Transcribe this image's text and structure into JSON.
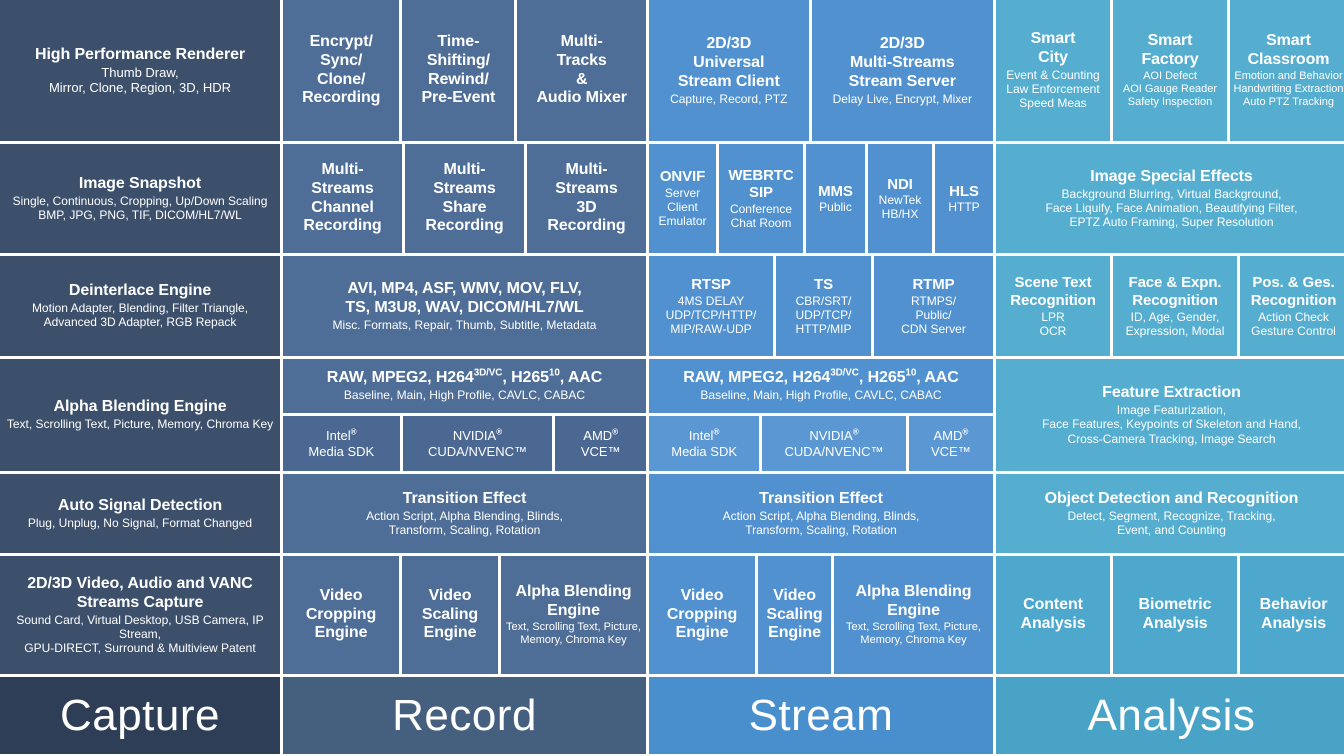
{
  "title": "Capture / Record / Stream / Analysis Feature Matrix",
  "colors": {
    "capture": "#3c4f6b",
    "record": "#4e6d97",
    "stream": "#5191cf",
    "analysis": "#55aed0",
    "footer_capture": "#2e3e56",
    "footer_record": "#45607f",
    "footer_stream": "#4a8fcd",
    "footer_analysis": "#48a3c6",
    "gap": "#ffffff"
  },
  "footer": {
    "capture": "Capture",
    "record": "Record",
    "stream": "Stream",
    "analysis": "Analysis"
  },
  "rows": [
    {
      "id": "row-1",
      "capture": {
        "title": "High Performance Renderer",
        "sub": [
          "Thumb Draw,",
          "Mirror, Clone, Region, 3D, HDR"
        ]
      },
      "record": [
        {
          "title": [
            "Encrypt/",
            "Sync/",
            "Clone/",
            "Recording"
          ]
        },
        {
          "title": [
            "Time-",
            "Shifting/",
            "Rewind/",
            "Pre-Event"
          ]
        },
        {
          "title": [
            "Multi-",
            "Tracks",
            "&",
            "Audio Mixer"
          ]
        }
      ],
      "stream": [
        {
          "title": [
            "2D/3D",
            "Universal",
            "Stream Client"
          ],
          "sub": [
            "Capture, Record, PTZ"
          ]
        },
        {
          "title": [
            "2D/3D",
            "Multi-Streams",
            "Stream Server"
          ],
          "sub": [
            "Delay Live, Encrypt, Mixer"
          ]
        }
      ],
      "analysis": [
        {
          "title": [
            "Smart",
            "City"
          ],
          "sub": [
            "Event & Counting",
            "Law Enforcement",
            "Speed Meas"
          ]
        },
        {
          "title": [
            "Smart",
            "Factory"
          ],
          "sub": [
            "AOI Defect",
            "AOI Gauge Reader",
            "Safety Inspection"
          ]
        },
        {
          "title": [
            "Smart",
            "Classroom"
          ],
          "sub": [
            "Emotion and Behavior",
            "Handwriting Extraction",
            "Auto PTZ Tracking"
          ]
        }
      ]
    },
    {
      "id": "row-2",
      "capture": {
        "title": "Image Snapshot",
        "sub": [
          "Single, Continuous, Cropping, Up/Down Scaling",
          "BMP, JPG, PNG, TIF, DICOM/HL7/WL"
        ]
      },
      "record": [
        {
          "title": [
            "Multi-",
            "Streams",
            "Channel",
            "Recording"
          ]
        },
        {
          "title": [
            "Multi-",
            "Streams",
            "Share",
            "Recording"
          ]
        },
        {
          "title": [
            "Multi-",
            "Streams",
            "3D",
            "Recording"
          ]
        }
      ],
      "stream": [
        {
          "title": [
            "ONVIF"
          ],
          "sub": [
            "Server",
            "Client",
            "Emulator"
          ]
        },
        {
          "title": [
            "WEBRTC",
            "SIP"
          ],
          "sub": [
            "Conference",
            "Chat Room"
          ]
        },
        {
          "title": [
            "MMS"
          ],
          "sub": [
            "Public"
          ]
        },
        {
          "title": [
            "NDI"
          ],
          "sub": [
            "NewTek",
            "HB/HX"
          ]
        },
        {
          "title": [
            "HLS"
          ],
          "sub": [
            "HTTP"
          ]
        }
      ],
      "analysis": [
        {
          "title": [
            "Image Special Effects"
          ],
          "sub": [
            "Background Blurring, Virtual Background,",
            "Face Liquify, Face Animation, Beautifying Filter,",
            "EPTZ Auto Framing, Super Resolution"
          ]
        }
      ]
    },
    {
      "id": "row-3",
      "capture": {
        "title": "Deinterlace Engine",
        "sub": [
          "Motion Adapter, Blending, Filter Triangle,",
          "Advanced 3D Adapter, RGB Repack"
        ]
      },
      "record": [
        {
          "title": [
            "AVI, MP4, ASF, WMV, MOV, FLV,",
            "TS, M3U8, WAV, DICOM/HL7/WL"
          ],
          "sub": [
            "Misc. Formats, Repair, Thumb, Subtitle, Metadata"
          ]
        }
      ],
      "stream": [
        {
          "title": [
            "RTSP"
          ],
          "sub": [
            "4MS DELAY",
            "UDP/TCP/HTTP/",
            "MIP/RAW-UDP"
          ]
        },
        {
          "title": [
            "TS"
          ],
          "sub": [
            "CBR/SRT/",
            "UDP/TCP/",
            "HTTP/MIP"
          ]
        },
        {
          "title": [
            "RTMP"
          ],
          "sub": [
            "RTMPS/",
            "Public/",
            "CDN Server"
          ]
        }
      ],
      "analysis": [
        {
          "title": [
            "Scene Text",
            "Recognition"
          ],
          "sub": [
            "LPR",
            "OCR"
          ]
        },
        {
          "title": [
            "Face & Expn.",
            "Recognition"
          ],
          "sub": [
            "ID, Age, Gender,",
            "Expression, Modal"
          ]
        },
        {
          "title": [
            "Pos. & Ges.",
            "Recognition"
          ],
          "sub": [
            "Action Check",
            "Gesture Control"
          ]
        }
      ]
    },
    {
      "id": "row-4",
      "capture": {
        "title": "Alpha Blending Engine",
        "sub": [
          "Text, Scrolling Text, Picture, Memory, Chroma Key"
        ]
      },
      "record_top": {
        "title_html": "RAW, MPEG2, H264<sup>3D/VC</sup>, H265<sup>10</sup>, AAC",
        "sub": [
          "Baseline, Main, High Profile, CAVLC, CABAC"
        ]
      },
      "record_bottom": [
        {
          "title_html": "Intel<sup>®</sup>",
          "sub": [
            "Media SDK"
          ]
        },
        {
          "title_html": "NVIDIA<sup>®</sup>",
          "sub": [
            "CUDA/NVENC™"
          ]
        },
        {
          "title_html": "AMD<sup>®</sup>",
          "sub": [
            "VCE™"
          ]
        }
      ],
      "stream_top": {
        "title_html": "RAW, MPEG2, H264<sup>3D/VC</sup>, H265<sup>10</sup>, AAC",
        "sub": [
          "Baseline, Main, High Profile, CAVLC, CABAC"
        ]
      },
      "stream_bottom": [
        {
          "title_html": "Intel<sup>®</sup>",
          "sub": [
            "Media SDK"
          ]
        },
        {
          "title_html": "NVIDIA<sup>®</sup>",
          "sub": [
            "CUDA/NVENC™"
          ]
        },
        {
          "title_html": "AMD<sup>®</sup>",
          "sub": [
            "VCE™"
          ]
        }
      ],
      "analysis": [
        {
          "title": [
            "Feature Extraction"
          ],
          "sub": [
            "Image Featurization,",
            "Face Features, Keypoints of Skeleton and Hand,",
            "Cross-Camera Tracking, Image Search"
          ]
        }
      ]
    },
    {
      "id": "row-5",
      "capture": {
        "title": "Auto Signal Detection",
        "sub": [
          "Plug, Unplug, No Signal, Format Changed"
        ]
      },
      "record": [
        {
          "title": [
            "Transition Effect"
          ],
          "sub": [
            "Action Script, Alpha Blending, Blinds,",
            "Transform, Scaling, Rotation"
          ]
        }
      ],
      "stream": [
        {
          "title": [
            "Transition Effect"
          ],
          "sub": [
            "Action Script, Alpha Blending, Blinds,",
            "Transform, Scaling, Rotation"
          ]
        }
      ],
      "analysis": [
        {
          "title": [
            "Object Detection and Recognition"
          ],
          "sub": [
            "Detect, Segment, Recognize, Tracking,",
            "Event, and Counting"
          ]
        }
      ]
    },
    {
      "id": "row-6",
      "capture": {
        "title_lines": [
          "2D/3D Video, Audio and VANC",
          "Streams Capture"
        ],
        "sub": [
          "Sound Card, Virtual Desktop, USB Camera, IP Stream,",
          "GPU-DIRECT, Surround & Multiview Patent"
        ]
      },
      "record": [
        {
          "title": [
            "Video",
            "Cropping",
            "Engine"
          ]
        },
        {
          "title": [
            "Video",
            "Scaling",
            "Engine"
          ]
        },
        {
          "title": [
            "Alpha Blending",
            "Engine"
          ],
          "sub": [
            "Text, Scrolling Text, Picture,",
            "Memory, Chroma Key"
          ]
        }
      ],
      "stream": [
        {
          "title": [
            "Video",
            "Cropping",
            "Engine"
          ]
        },
        {
          "title": [
            "Video",
            "Scaling",
            "Engine"
          ]
        },
        {
          "title": [
            "Alpha Blending",
            "Engine"
          ],
          "sub": [
            "Text, Scrolling Text, Picture,",
            "Memory, Chroma Key"
          ]
        }
      ],
      "analysis": [
        {
          "title": [
            "Content",
            "Analysis"
          ]
        },
        {
          "title": [
            "Biometric",
            "Analysis"
          ]
        },
        {
          "title": [
            "Behavior",
            "Analysis"
          ]
        }
      ]
    }
  ]
}
